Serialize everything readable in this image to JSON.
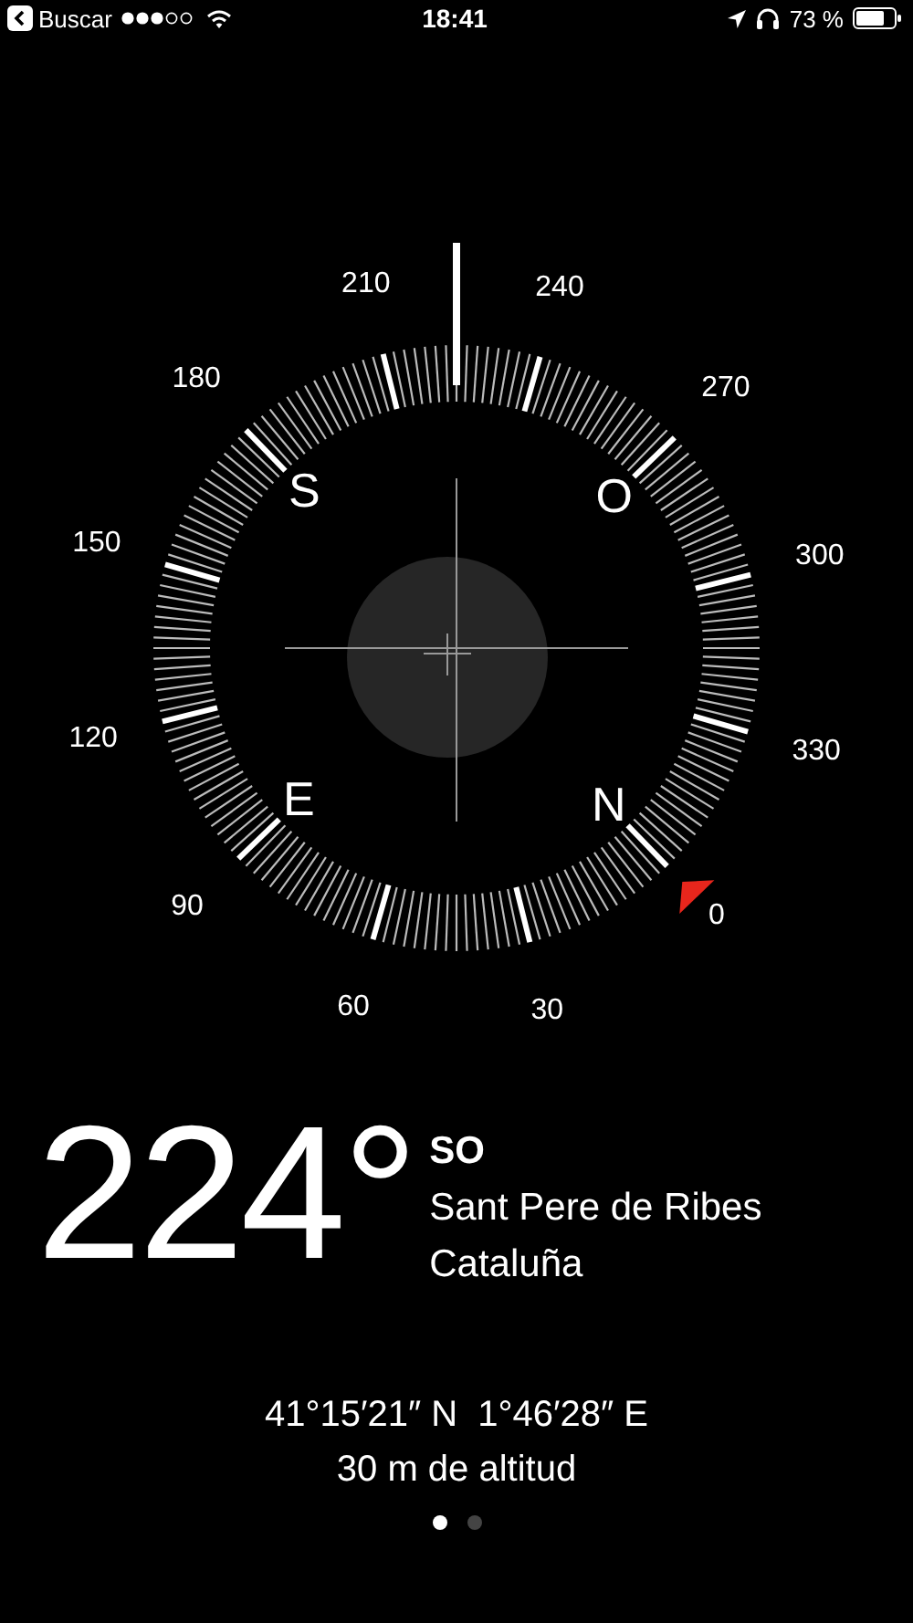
{
  "status_bar": {
    "back_label": "Buscar",
    "time": "18:41",
    "battery": "73 %"
  },
  "compass": {
    "degree_labels": [
      "0",
      "30",
      "60",
      "90",
      "120",
      "150",
      "180",
      "210",
      "240",
      "270",
      "300",
      "330"
    ],
    "cardinals": [
      "S",
      "O",
      "E",
      "N"
    ]
  },
  "readout": {
    "heading": "224°",
    "direction": "SO",
    "place": [
      "Sant Pere de Ribes",
      "Cataluña"
    ]
  },
  "coordinates": "41°15′21″ N  1°46′28″ E",
  "altitude": "30 m de altitud",
  "page_dots": [
    {
      "selected": true
    },
    {
      "selected": false
    }
  ]
}
